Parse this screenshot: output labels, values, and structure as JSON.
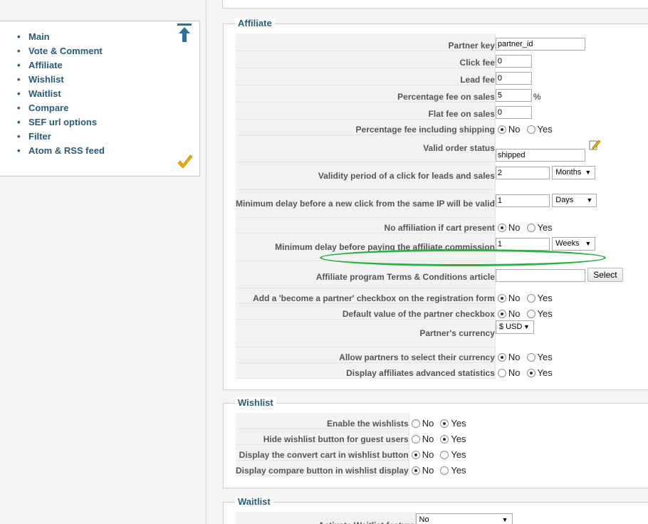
{
  "sidebar": {
    "items": [
      "Main",
      "Vote & Comment",
      "Affiliate",
      "Wishlist",
      "Waitlist",
      "Compare",
      "SEF url options",
      "Filter",
      "Atom & RSS feed"
    ]
  },
  "affiliate": {
    "legend": "Affiliate",
    "partner_key": {
      "label": "Partner key",
      "value": "partner_id"
    },
    "click_fee": {
      "label": "Click fee",
      "value": "0"
    },
    "lead_fee": {
      "label": "Lead fee",
      "value": "0"
    },
    "percentage_fee": {
      "label": "Percentage fee on sales",
      "value": "5",
      "unit": "%"
    },
    "flat_fee": {
      "label": "Flat fee on sales",
      "value": "0"
    },
    "pct_incl_shipping": {
      "label": "Percentage fee including shipping"
    },
    "valid_order_status": {
      "label": "Valid order status",
      "value": "shipped"
    },
    "validity_period": {
      "label": "Validity period of a click for leads and sales",
      "value": "2",
      "unit": "Months"
    },
    "min_delay_click": {
      "label": "Minimum delay before a new click from the same IP will be valid",
      "value": "1",
      "unit": "Days"
    },
    "no_affil_cart": {
      "label": "No affiliation if cart present"
    },
    "min_delay_commission": {
      "label": "Minimum delay before paying the affiliate commission",
      "value": "1",
      "unit": "Weeks"
    },
    "terms_article": {
      "label": "Affiliate program Terms & Conditions article",
      "value": "",
      "button": "Select"
    },
    "become_partner": {
      "label": "Add a 'become a partner' checkbox on the registration form"
    },
    "default_partner": {
      "label": "Default value of the partner checkbox"
    },
    "currency": {
      "label": "Partner's currency",
      "value": "$ USD"
    },
    "allow_currency": {
      "label": "Allow partners to select their currency"
    },
    "adv_stats": {
      "label": "Display affiliates advanced statistics"
    }
  },
  "wishlist": {
    "legend": "Wishlist",
    "enable": {
      "label": "Enable the wishlists"
    },
    "hide_guest": {
      "label": "Hide wishlist button for guest users"
    },
    "convert_cart": {
      "label": "Display the convert cart in wishlist button"
    },
    "compare_btn": {
      "label": "Display compare button in wishlist display"
    }
  },
  "waitlist": {
    "legend": "Waitlist",
    "activate": {
      "label": "Activate Waitlist feature",
      "value": "No"
    }
  },
  "options": {
    "no": "No",
    "yes": "Yes"
  },
  "icons": {
    "top": "arrow-up-icon",
    "apply": "checkmark-icon",
    "edit": "edit-pencil-icon"
  },
  "colors": {
    "link": "#2a5b78",
    "highlight": "#2fae44",
    "check": "#f2a900"
  }
}
